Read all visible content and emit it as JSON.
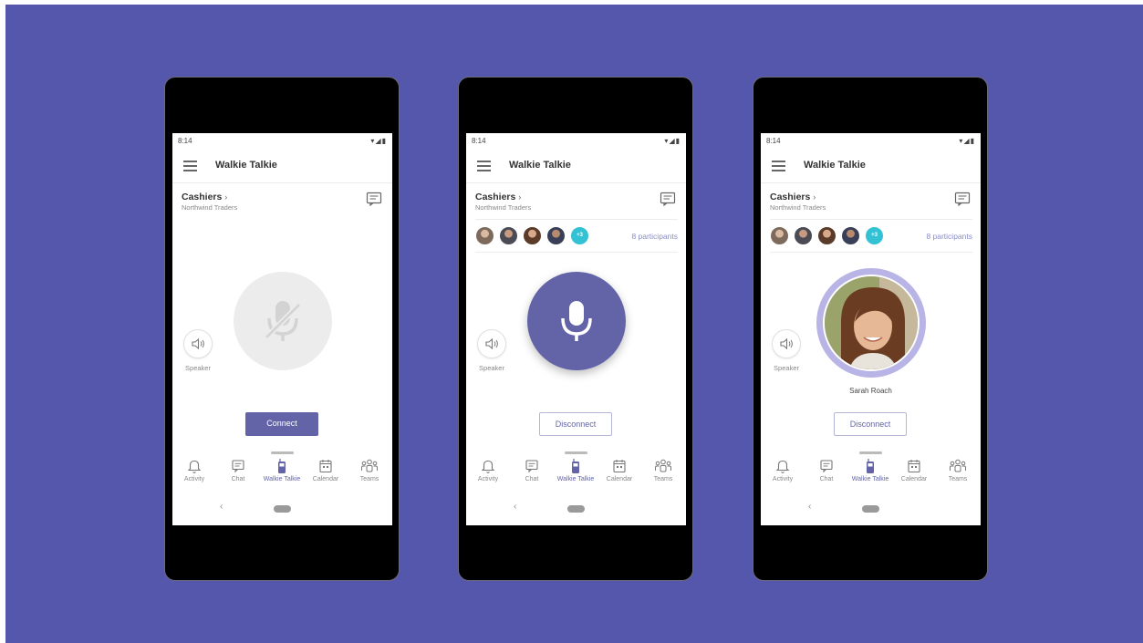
{
  "background_color": "#5557ad",
  "accent_color": "#6264a7",
  "phones": [
    {
      "status_time": "8:14",
      "app_title": "Walkie Talkie",
      "channel_name": "Cashiers",
      "team_name": "Northwind Traders",
      "speaker_label": "Speaker",
      "mic_state": "muted",
      "button_label": "Connect",
      "tabs": [
        "Activity",
        "Chat",
        "Walkie Talkie",
        "Calendar",
        "Teams"
      ],
      "active_tab": "Walkie Talkie"
    },
    {
      "status_time": "8:14",
      "app_title": "Walkie Talkie",
      "channel_name": "Cashiers",
      "team_name": "Northwind Traders",
      "participant_badge": "+3",
      "participants_count": "8 participants",
      "speaker_label": "Speaker",
      "mic_state": "active",
      "button_label": "Disconnect",
      "tabs": [
        "Activity",
        "Chat",
        "Walkie Talkie",
        "Calendar",
        "Teams"
      ],
      "active_tab": "Walkie Talkie"
    },
    {
      "status_time": "8:14",
      "app_title": "Walkie Talkie",
      "channel_name": "Cashiers",
      "team_name": "Northwind Traders",
      "participant_badge": "+3",
      "participants_count": "8 participants",
      "speaker_label": "Speaker",
      "mic_state": "speaking",
      "current_speaker": "Sarah Roach",
      "button_label": "Disconnect",
      "tabs": [
        "Activity",
        "Chat",
        "Walkie Talkie",
        "Calendar",
        "Teams"
      ],
      "active_tab": "Walkie Talkie"
    }
  ]
}
